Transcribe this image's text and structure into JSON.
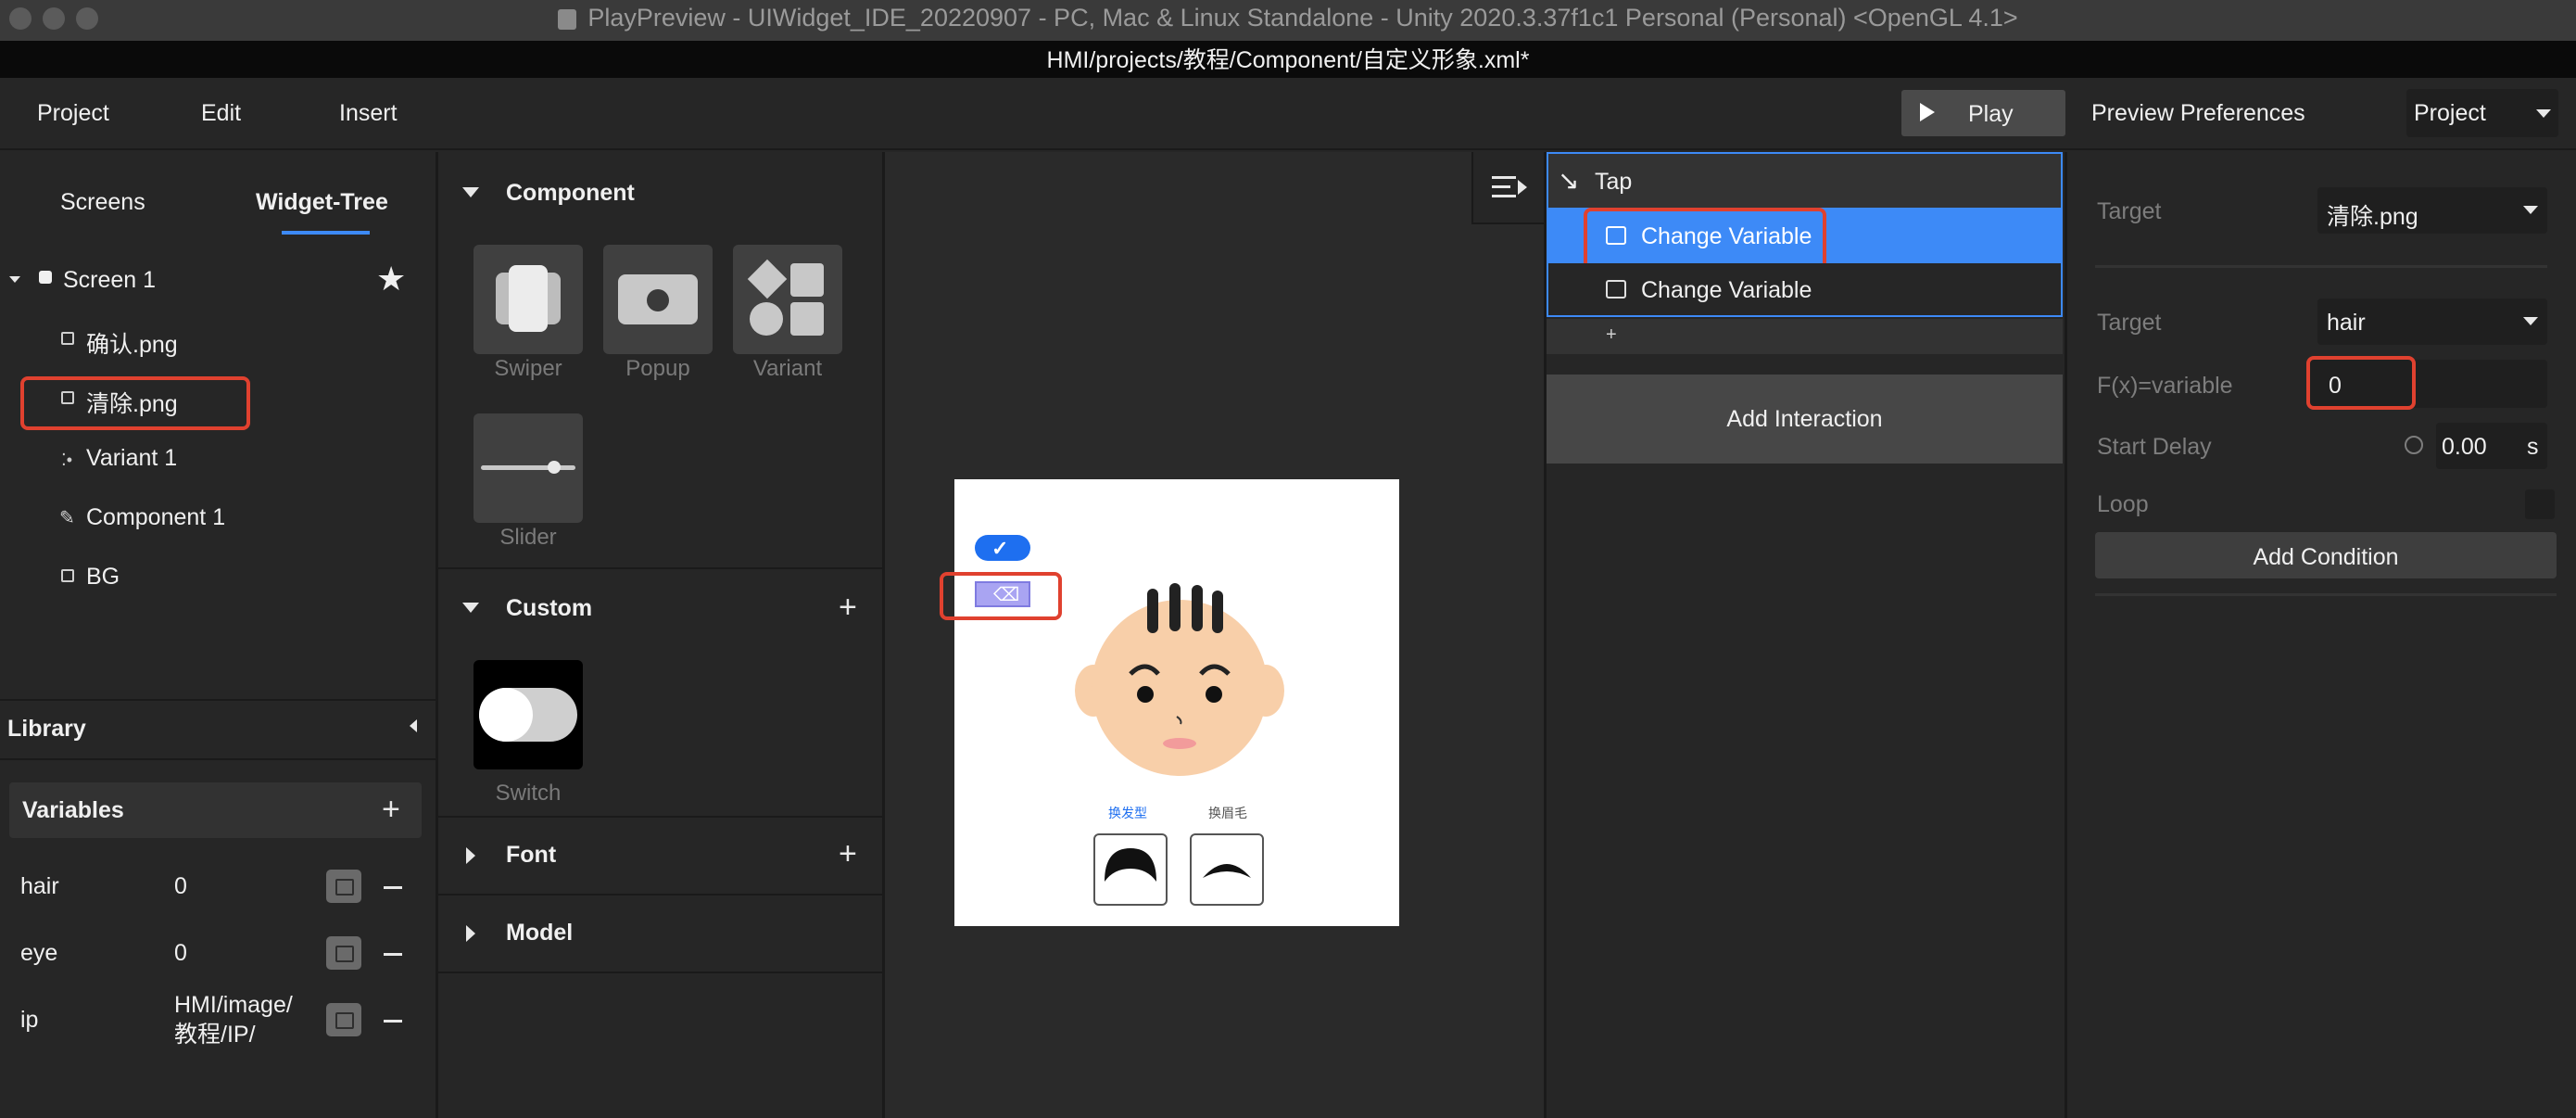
{
  "window": {
    "title": "PlayPreview - UIWidget_IDE_20220907 - PC, Mac & Linux Standalone - Unity 2020.3.37f1c1 Personal (Personal) <OpenGL 4.1>",
    "path": "HMI/projects/教程/Component/自定义形象.xml*"
  },
  "menu": {
    "project": "Project",
    "edit": "Edit",
    "insert": "Insert",
    "play": "Play",
    "preview_preferences": "Preview Preferences",
    "project_select": "Project"
  },
  "left": {
    "tabs": {
      "screens": "Screens",
      "widget_tree": "Widget-Tree"
    },
    "tree": {
      "root": "Screen 1",
      "items": [
        "确认.png",
        "清除.png",
        "Variant 1",
        "Component 1",
        "BG"
      ]
    },
    "library": "Library",
    "variables_title": "Variables",
    "variables": [
      {
        "name": "hair",
        "value": "0"
      },
      {
        "name": "eye",
        "value": "0"
      },
      {
        "name": "ip",
        "value": "HMI/image/\n教程/IP/"
      }
    ]
  },
  "components": {
    "component_title": "Component",
    "items": [
      "Swiper",
      "Popup",
      "Variant",
      "Slider"
    ],
    "custom_title": "Custom",
    "custom_items": [
      "Switch"
    ],
    "font_title": "Font",
    "model_title": "Model"
  },
  "canvas": {
    "label_left": "换发型",
    "label_right": "换眉毛"
  },
  "interactions": {
    "trigger": "Tap",
    "actions": [
      "Change Variable",
      "Change Variable"
    ],
    "add_small": "+",
    "add_interaction": "Add Interaction"
  },
  "properties": {
    "target1_label": "Target",
    "target1_value": "清除.png",
    "target2_label": "Target",
    "target2_value": "hair",
    "fx_label": "F(x)=variable",
    "fx_value": "0",
    "start_delay_label": "Start Delay",
    "start_delay_value": "0.00",
    "start_delay_unit": "s",
    "loop_label": "Loop",
    "add_condition": "Add Condition"
  },
  "colors": {
    "accent": "#3d8af7",
    "highlight_box": "#e0412f",
    "panel": "#262626",
    "field": "#1f1f1f"
  }
}
